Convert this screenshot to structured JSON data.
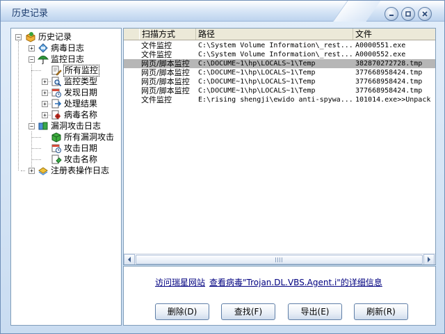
{
  "window": {
    "title": "历史记录"
  },
  "tree": {
    "root": "历史记录",
    "items": [
      {
        "label": "病毒日志"
      },
      {
        "label": "监控日志"
      },
      {
        "label": "所有监控"
      },
      {
        "label": "监控类型"
      },
      {
        "label": "发现日期"
      },
      {
        "label": "处理结果"
      },
      {
        "label": "病毒名称"
      },
      {
        "label": "漏洞攻击日志"
      },
      {
        "label": "所有漏洞攻击"
      },
      {
        "label": "攻击日期"
      },
      {
        "label": "攻击名称"
      },
      {
        "label": "注册表操作日志"
      }
    ]
  },
  "list": {
    "columns": [
      "扫描方式",
      "路径",
      "文件"
    ],
    "rows": [
      [
        "文件监控",
        "C:\\System Volume Information\\_rest...",
        "A0000551.exe"
      ],
      [
        "文件监控",
        "C:\\System Volume Information\\_rest...",
        "A0000552.exe"
      ],
      [
        "网页/脚本监控",
        "C:\\DOCUME~1\\hp\\LOCALS~1\\Temp",
        "382870272728.tmp"
      ],
      [
        "网页/脚本监控",
        "C:\\DOCUME~1\\hp\\LOCALS~1\\Temp",
        "377668958424.tmp"
      ],
      [
        "网页/脚本监控",
        "C:\\DOCUME~1\\hp\\LOCALS~1\\Temp",
        "377668958424.tmp"
      ],
      [
        "网页/脚本监控",
        "C:\\DOCUME~1\\hp\\LOCALS~1\\Temp",
        "377668958424.tmp"
      ],
      [
        "文件监控",
        "E:\\rising shengji\\ewido anti-spywa...",
        "101014.exe>>Unpack"
      ]
    ],
    "selected_row": 2
  },
  "links": {
    "visit_site": "访问瑞星网站",
    "virus_info": "查看病毒\"Trojan.DL.VBS.Agent.i\"的详细信息"
  },
  "buttons": {
    "delete": "删除(D)",
    "find": "查找(F)",
    "export": "导出(E)",
    "refresh": "刷新(R)"
  },
  "colors": {
    "selection": "#b6b6b6",
    "link": "#000080",
    "border": "#7f9db9"
  }
}
